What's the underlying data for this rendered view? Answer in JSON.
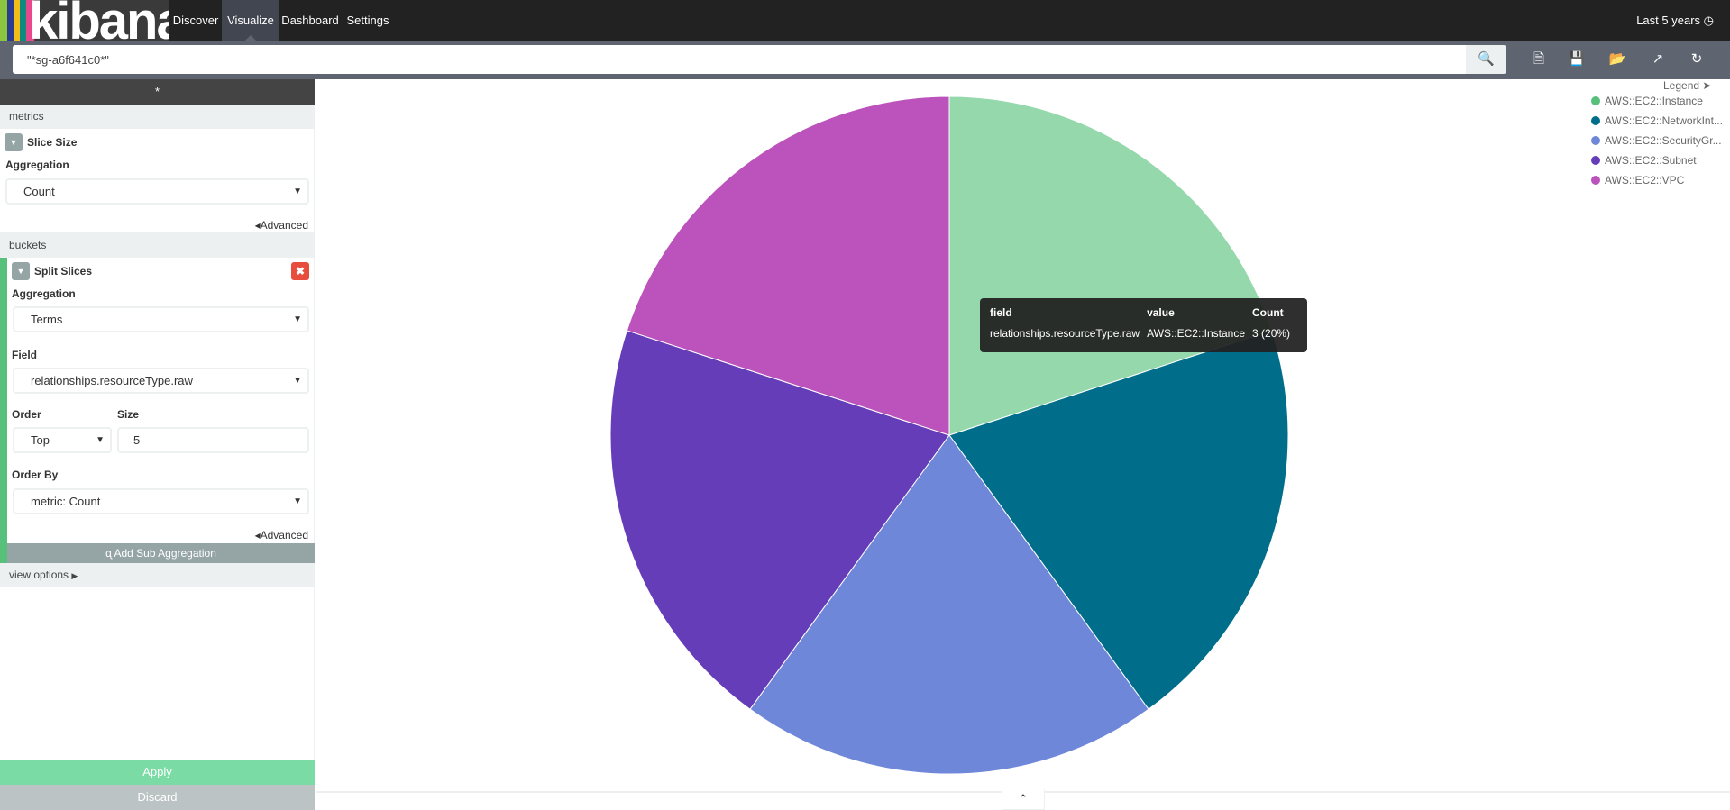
{
  "nav": {
    "logo": "kibana",
    "items": [
      {
        "label": "Discover"
      },
      {
        "label": "Visualize",
        "active": true
      },
      {
        "label": "Dashboard"
      },
      {
        "label": "Settings"
      }
    ],
    "time": "Last 5 years",
    "time_icon": "clock-icon"
  },
  "toolbar": {
    "query": "\"*sg-a6f641c0*\"",
    "icons": [
      "search-icon",
      "new-visualization-icon",
      "save-icon",
      "open-icon",
      "share-icon",
      "refresh-icon"
    ]
  },
  "sidebar": {
    "title": "*",
    "metrics_header": "metrics",
    "metric": {
      "title": "Slice Size",
      "agg_label": "Aggregation",
      "agg_value": "Count",
      "advanced": "Advanced"
    },
    "buckets_header": "buckets",
    "bucket": {
      "title": "Split Slices",
      "agg_label": "Aggregation",
      "agg_value": "Terms",
      "field_label": "Field",
      "field_value": "relationships.resourceType.raw",
      "order_label": "Order",
      "order_value": "Top",
      "size_label": "Size",
      "size_value": "5",
      "orderby_label": "Order By",
      "orderby_value": "metric: Count",
      "advanced": "Advanced"
    },
    "add_sub": "Add Sub Aggregation",
    "view_options": "view options",
    "apply": "Apply",
    "discard": "Discard",
    "accent": "#57c17b"
  },
  "chart_data": {
    "type": "pie",
    "legend_title": "Legend",
    "legend_position": "top-right",
    "categories": [
      "AWS::EC2::Instance",
      "AWS::EC2::NetworkInt...",
      "AWS::EC2::SecurityGr...",
      "AWS::EC2::Subnet",
      "AWS::EC2::VPC"
    ],
    "values": [
      3,
      3,
      3,
      3,
      3
    ],
    "colors": [
      "#57c17b",
      "#006e8a",
      "#6f87d8",
      "#663db8",
      "#bc52bc"
    ],
    "hover_color": "#94d8ab",
    "hovered_index": 0
  },
  "tooltip": {
    "headers": [
      "field",
      "value",
      "Count"
    ],
    "row": [
      "relationships.resourceType.raw",
      "AWS::EC2::Instance",
      "3 (20%)"
    ]
  }
}
